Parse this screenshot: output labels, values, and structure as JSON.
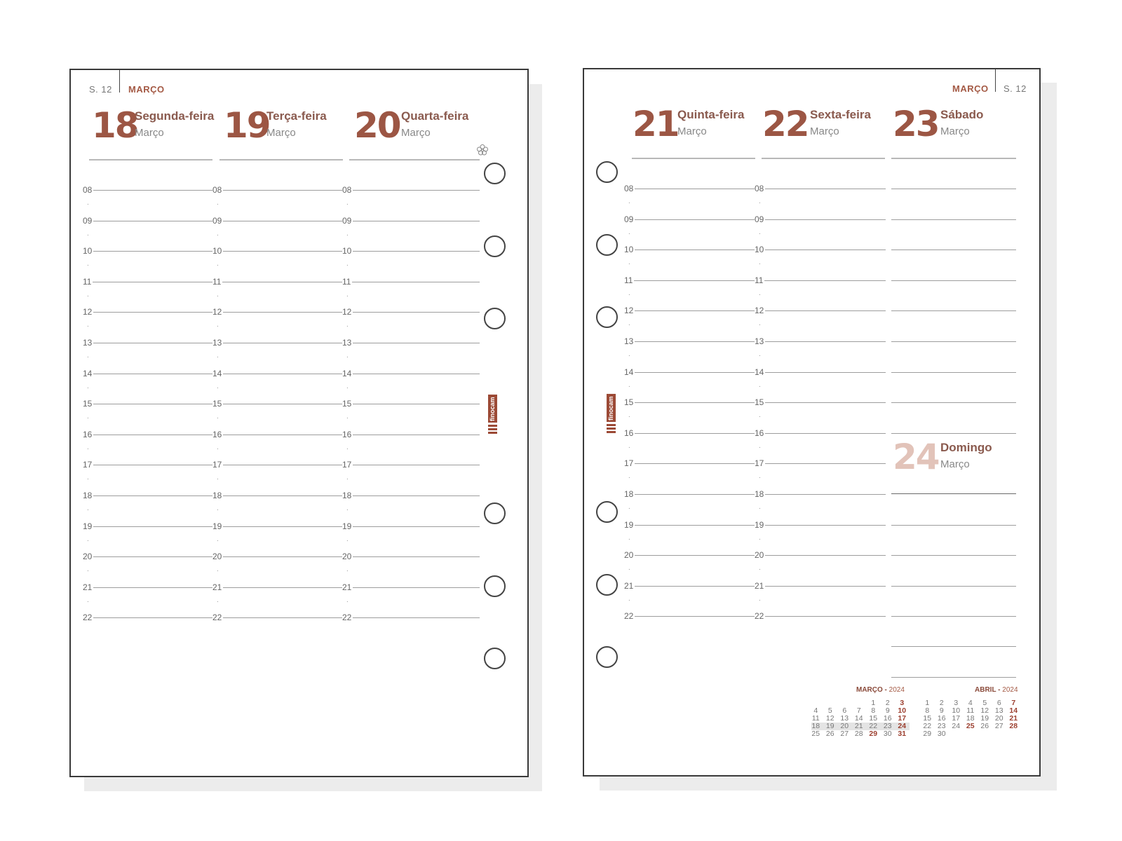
{
  "left_page": {
    "week_label": "S. 12",
    "month_label": "MARÇO",
    "days": [
      {
        "num": "18",
        "name": "Segunda-feira",
        "month": "Março"
      },
      {
        "num": "19",
        "name": "Terça-feira",
        "month": "Março"
      },
      {
        "num": "20",
        "name": "Quarta-feira",
        "month": "Março"
      }
    ],
    "spring_icon": "flower-icon"
  },
  "right_page": {
    "week_label": "S. 12",
    "month_label": "MARÇO",
    "days": [
      {
        "num": "21",
        "name": "Quinta-feira",
        "month": "Março"
      },
      {
        "num": "22",
        "name": "Sexta-feira",
        "month": "Março"
      },
      {
        "num": "23",
        "name": "Sábado",
        "month": "Março"
      }
    ],
    "sunday": {
      "num": "24",
      "name": "Domingo",
      "month": "Março"
    }
  },
  "hours": [
    "08",
    "09",
    "10",
    "11",
    "12",
    "13",
    "14",
    "15",
    "16",
    "17",
    "18",
    "19",
    "20",
    "21",
    "22"
  ],
  "half_hour_marker": ".",
  "brand": "finocam",
  "mini_calendars": [
    {
      "month": "MARÇO",
      "year": "2024",
      "weeks": [
        [
          "",
          "",
          "",
          "",
          "1",
          "2",
          "3"
        ],
        [
          "4",
          "5",
          "6",
          "7",
          "8",
          "9",
          "10"
        ],
        [
          "11",
          "12",
          "13",
          "14",
          "15",
          "16",
          "17"
        ],
        [
          "18",
          "19",
          "20",
          "21",
          "22",
          "23",
          "24"
        ],
        [
          "25",
          "26",
          "27",
          "28",
          "29",
          "30",
          "31"
        ]
      ],
      "holidays": [
        "29"
      ],
      "current_week": 3
    },
    {
      "month": "ABRIL",
      "year": "2024",
      "weeks": [
        [
          "1",
          "2",
          "3",
          "4",
          "5",
          "6",
          "7"
        ],
        [
          "8",
          "9",
          "10",
          "11",
          "12",
          "13",
          "14"
        ],
        [
          "15",
          "16",
          "17",
          "18",
          "19",
          "20",
          "21"
        ],
        [
          "22",
          "23",
          "24",
          "25",
          "26",
          "27",
          "28"
        ],
        [
          "29",
          "30",
          "",
          "",
          "",
          "",
          ""
        ]
      ],
      "holidays": [
        "25"
      ],
      "current_week": -1
    }
  ],
  "colors": {
    "accent": "#9c5644",
    "sunday_num": "#e2c3b9",
    "brand": "#9c4a36",
    "border": "#3a3a3a",
    "shadow": "#ececec"
  }
}
